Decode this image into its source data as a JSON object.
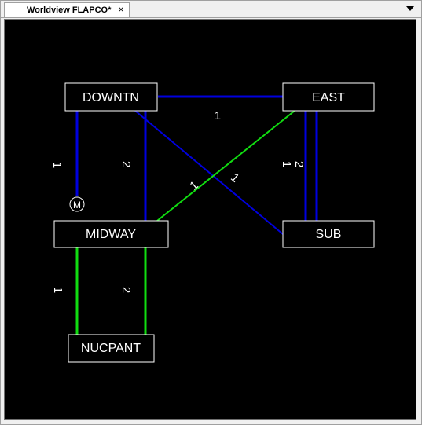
{
  "tab": {
    "title": "Worldview FLAPCO*",
    "close_glyph": "×"
  },
  "colors": {
    "blue_line": "#0000dd",
    "green_line": "#11dd11",
    "node_border": "#ffffff",
    "background": "#000000"
  },
  "nodes": {
    "downtn": "DOWNTN",
    "east": "EAST",
    "midway": "MIDWAY",
    "sub": "SUB",
    "nucpant": "NUCPANT"
  },
  "meter_symbol": "M",
  "line_labels": {
    "downtn_east": "1",
    "downtn_midway_1": "1",
    "downtn_midway_2": "2",
    "east_sub_1": "1",
    "east_sub_2": "2",
    "downtn_sub": "1",
    "east_midway": "1",
    "midway_nucpant_1": "1",
    "midway_nucpant_2": "2"
  }
}
